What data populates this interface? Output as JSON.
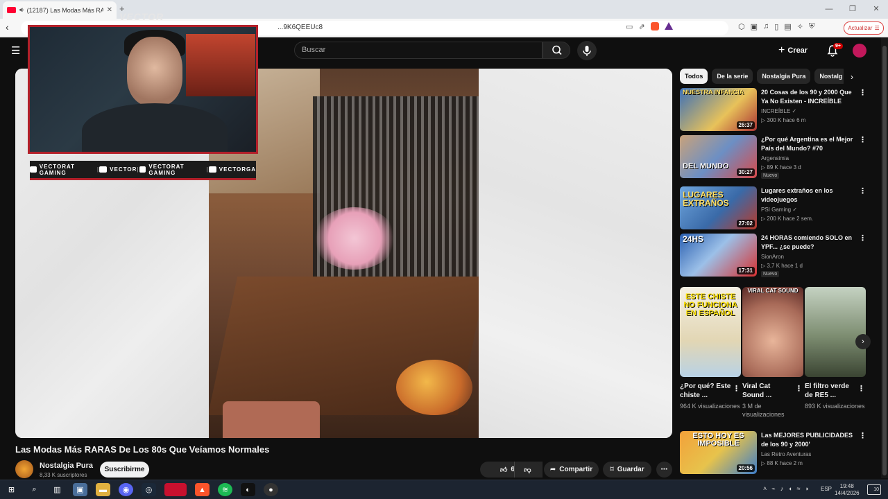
{
  "browser": {
    "tab_title": "(12187) Las Modas Más RAR",
    "url": "...9K6QEEUc8",
    "update_label": "Actualizar"
  },
  "header": {
    "search_placeholder": "Buscar",
    "create_label": "Crear",
    "notif_count": "9+"
  },
  "overlay": {
    "label": "VECTOR",
    "socials": [
      "VECTORAT GAMING",
      "VECTOR",
      "VECTORAT GAMING",
      "VECTORGA"
    ]
  },
  "video": {
    "title": "Las Modas Más RARAS De Los 80s Que Veíamos Normales",
    "channel": "Nostalgia Pura",
    "subscribers": "8,33 K suscriptores",
    "subscribe_label": "Suscribirme",
    "likes": "689",
    "share_label": "Compartir",
    "save_label": "Guardar"
  },
  "chips": [
    "Todos",
    "De la serie",
    "Nostalgia Pura",
    "Nostalg"
  ],
  "recommendations": [
    {
      "title": "20 Cosas de los 90 y 2000 Que Ya No Existen - INCREÍBLE",
      "channel": "INCREÍBLE ✓",
      "meta": "▷ 300 K  hace 6 m",
      "duration": "26:37",
      "thumb_text": "NUESTRA INFANCIA",
      "badge": ""
    },
    {
      "title": "¿Por qué Argentina es el Mejor País del Mundo? #70",
      "channel": "Argensimia",
      "meta": "▷ 89 K  hace 3 d",
      "duration": "30:27",
      "thumb_text": "DEL MUNDO",
      "badge": "Nuevo"
    },
    {
      "title": "Lugares extraños en los videojuegos",
      "channel": "PSI Gaming ✓",
      "meta": "▷ 200 K  hace 2 sem.",
      "duration": "27:02",
      "thumb_text": "LUGARES EXTRAÑOS",
      "badge": ""
    },
    {
      "title": "24 HORAS comiendo SOLO en YPF... ¿se puede?",
      "channel": "SionAron",
      "meta": "▷ 3,7 K  hace 1 d",
      "duration": "17:31",
      "thumb_text": "24HS",
      "badge": "Nuevo"
    },
    {
      "title": "Las MEJORES PUBLICIDADES de los 90 y 2000'",
      "channel": "Las Retro Aventuras",
      "meta": "▷ 88 K  hace 2 m",
      "duration": "20:56",
      "thumb_text": "ESTO HOY ES IMPOSIBLE",
      "badge": ""
    }
  ],
  "shorts": [
    {
      "title": "¿Por qué? Este chiste ...",
      "views": "964 K visualizaciones",
      "thumb_text": "ESTE CHISTE NO FUNCIONA EN ESPAÑOL"
    },
    {
      "title": "Viral Cat Sound ...",
      "views": "3 M de visualizaciones",
      "thumb_text": "VIRAL CAT SOUND"
    },
    {
      "title": "El filtro verde de RE5 ...",
      "views": "893 K visualizaciones",
      "thumb_text": ""
    }
  ],
  "taskbar": {
    "lang": "ESP",
    "time": "19:48",
    "date": "14/4/2026",
    "notif": "10"
  },
  "colors": {
    "yt_bg": "#0f0f0f",
    "accent_red": "#b3202a",
    "chip_bg": "#272727"
  }
}
